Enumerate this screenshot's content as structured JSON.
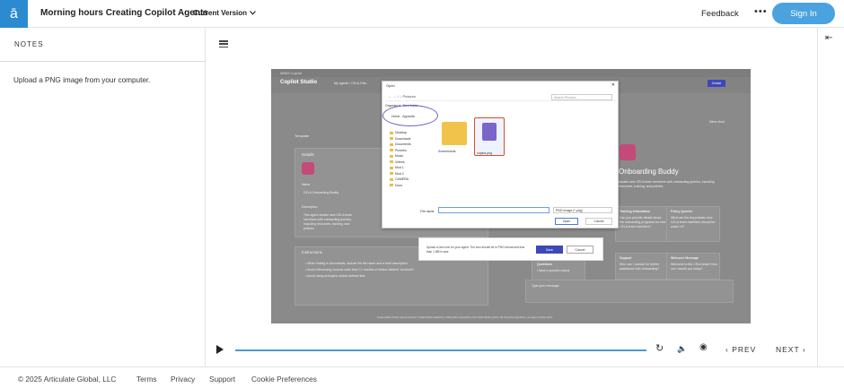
{
  "header": {
    "logo_glyph": "ā",
    "course_title": "Morning hours Creating Copilot Agents",
    "version_label": "Current Version",
    "feedback_label": "Feedback",
    "more_label": "•••",
    "signin_label": "Sign In",
    "accent_color": "#4aa3df"
  },
  "notes": {
    "title": "NOTES",
    "text": "Upload a PNG image from your computer."
  },
  "slide": {
    "browser_tab": "MB65 Copilot",
    "app_name": "Copilot Studio",
    "breadcrumb": "My agents  /  CELA Onb...",
    "create_label": "Create",
    "new_chat_label": "New chat",
    "template_label": "Template",
    "details_label": "Details",
    "name_label": "Name",
    "name_value": "CELA Onboarding Buddy",
    "description_label": "Description",
    "description_value": "This agent assists new CELA team members with onboarding queries, including resources, training, and policies.",
    "instructions_label": "Instructions",
    "instructions_lines": [
      "• When linking to documents, include the file name and a brief description.",
      "• Avoid referencing sources older than 12 months or folders labeled \"archived\".",
      "• Avoid using acronyms unless defined first."
    ],
    "agent_title": "Onboarding Buddy",
    "agent_desc": "Assists new CELA team members with onboarding queries, including resources, training, and policies.",
    "cards": [
      {
        "title": "Training information",
        "body": "Can you provide details about the onboarding programs for new CELA team members?"
      },
      {
        "title": "Policy Queries",
        "body": "What are the key policies new CELA team members should be aware of?"
      },
      {
        "title": "Support",
        "body": "Who can I contact for further assistance with onboarding?"
      },
      {
        "title": "Welcome Message",
        "body": "Welcome to the CELA team! How can I assist you today?"
      },
      {
        "title": "Questions",
        "body": "I have a question about"
      }
    ],
    "message_placeholder": "Type your message",
    "footer_note": "AI-generated content may be incorrect. Copilot Studio assistance in Microsoft is powered by the Copilot Studio service. By using this experience, you agree to these terms."
  },
  "dialog": {
    "title": "Open",
    "path": "←  →  ↑  ↓    Pictures",
    "search_placeholder": "Search Pictures",
    "toolbar_organize": "Organize ▾",
    "toolbar_new_folder": "New folder",
    "home_label": "Home - Appwrite",
    "sidebar_items": [
      "Desktop",
      "Downloads",
      "Documents",
      "Pictures",
      "Music",
      "Videos",
      "Mod 1",
      "Mod 2",
      "CAMERA",
      "Docs"
    ],
    "folder_label": "Screenshots",
    "file_label": "copilot.png",
    "filename_label": "File name:",
    "filetype_value": "PNG Image (*.png)",
    "open_label": "Open",
    "cancel_label": "Cancel"
  },
  "upload_panel": {
    "text": "Upload a new icon for your agent. The icon should be in PNG format and less than 1 MB in size.",
    "save_label": "Save",
    "cancel_label": "Cancel"
  },
  "player": {
    "progress": 1.0,
    "replay_icon": "↻",
    "volume_icon": "🔈",
    "cc_icon": "◉",
    "prev_label": "PREV",
    "next_label": "NEXT"
  },
  "footer": {
    "copyright": "© 2025 Articulate Global, LLC",
    "terms": "Terms",
    "privacy": "Privacy",
    "support": "Support",
    "cookies": "Cookie Preferences"
  }
}
